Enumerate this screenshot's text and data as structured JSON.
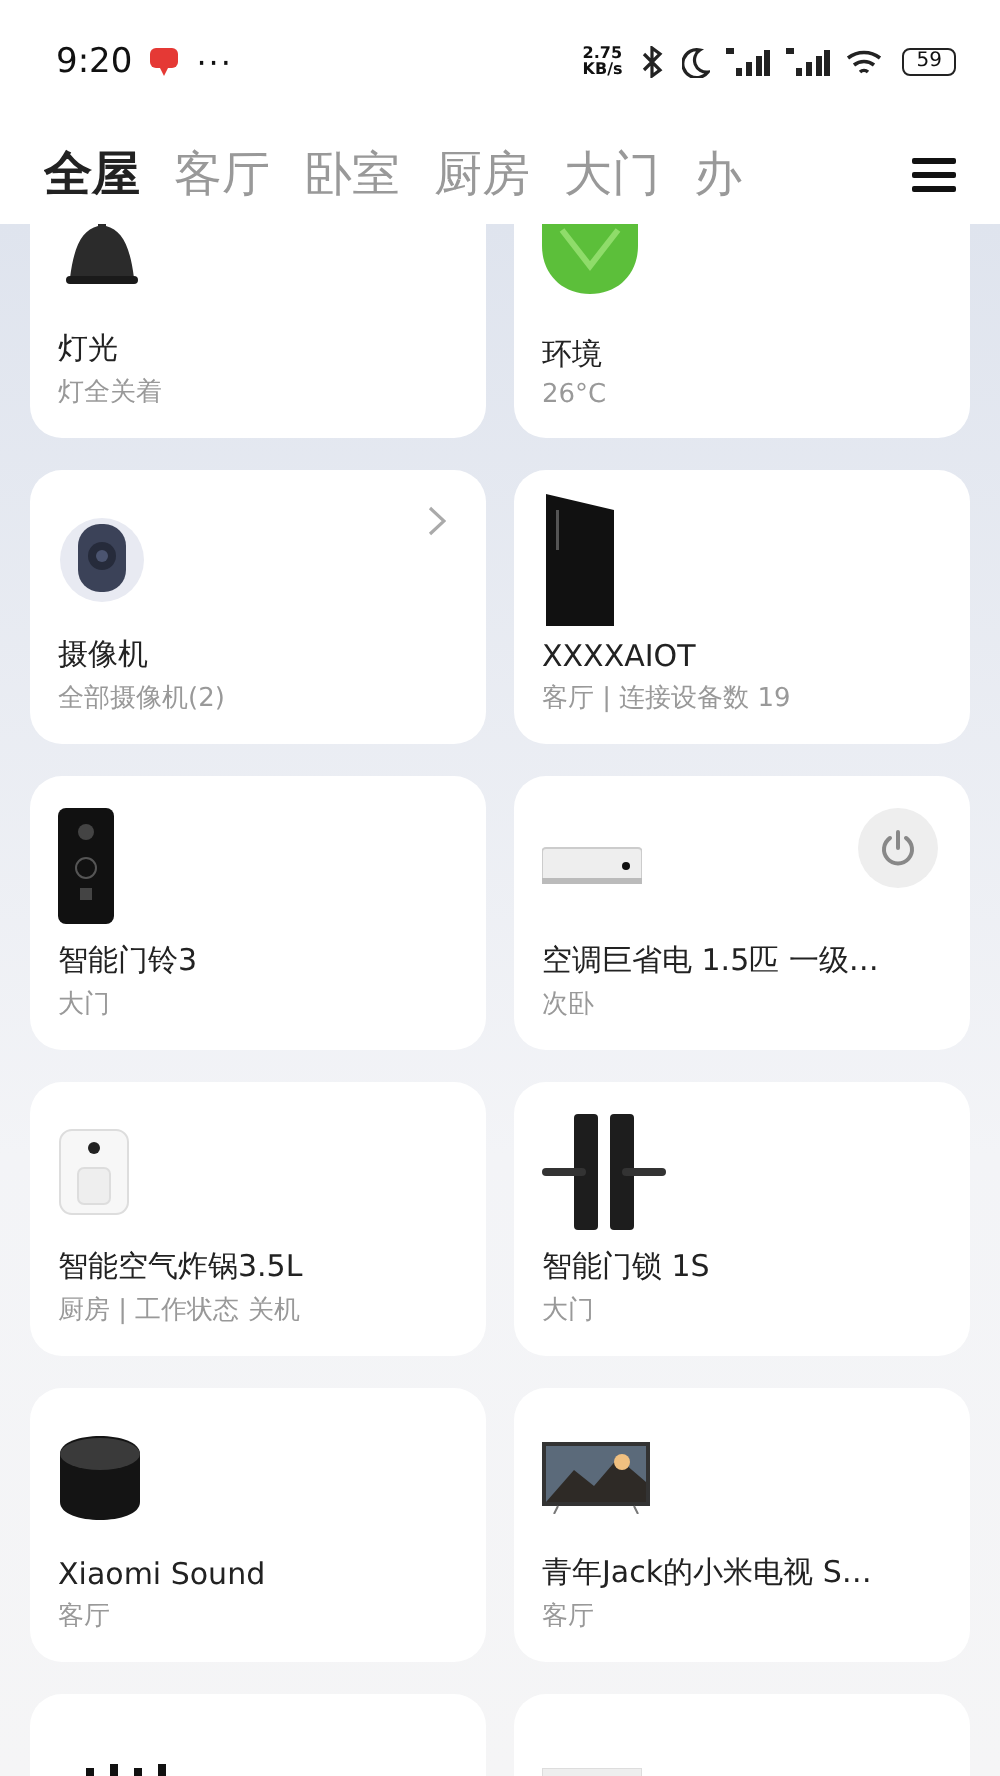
{
  "status_bar": {
    "time": "9:20",
    "more": "···",
    "speed_value": "2.75",
    "speed_unit": "KB/s",
    "battery": "59"
  },
  "tabs": [
    {
      "label": "全屋",
      "selected": true
    },
    {
      "label": "客厅",
      "selected": false
    },
    {
      "label": "卧室",
      "selected": false
    },
    {
      "label": "厨房",
      "selected": false
    },
    {
      "label": "大门",
      "selected": false
    },
    {
      "label": "办",
      "selected": false
    }
  ],
  "devices": [
    {
      "kind": "lamp",
      "name": "灯光",
      "subtitle": "灯全关着"
    },
    {
      "kind": "leaf",
      "name": "环境",
      "subtitle": "26°C"
    },
    {
      "kind": "camera",
      "name": "摄像机",
      "subtitle": "全部摄像机(2)",
      "chevron": true
    },
    {
      "kind": "tower",
      "name": "XXXXAIOT",
      "subtitle": "客厅 | 连接设备数 19"
    },
    {
      "kind": "doorbell",
      "name": "智能门铃3",
      "subtitle": "大门"
    },
    {
      "kind": "ac",
      "name": "空调巨省电 1.5匹 一级…",
      "subtitle": "次卧",
      "power_button": true
    },
    {
      "kind": "fryer",
      "name": "智能空气炸锅3.5L",
      "subtitle": "厨房 | 工作状态 关机"
    },
    {
      "kind": "lock",
      "name": "智能门锁 1S",
      "subtitle": "大门"
    },
    {
      "kind": "speaker",
      "name": "Xiaomi Sound",
      "subtitle": "客厅"
    },
    {
      "kind": "tv",
      "name": "青年Jack的小米电视 S…",
      "subtitle": "客厅"
    },
    {
      "kind": "antennas"
    },
    {
      "kind": "box"
    }
  ]
}
